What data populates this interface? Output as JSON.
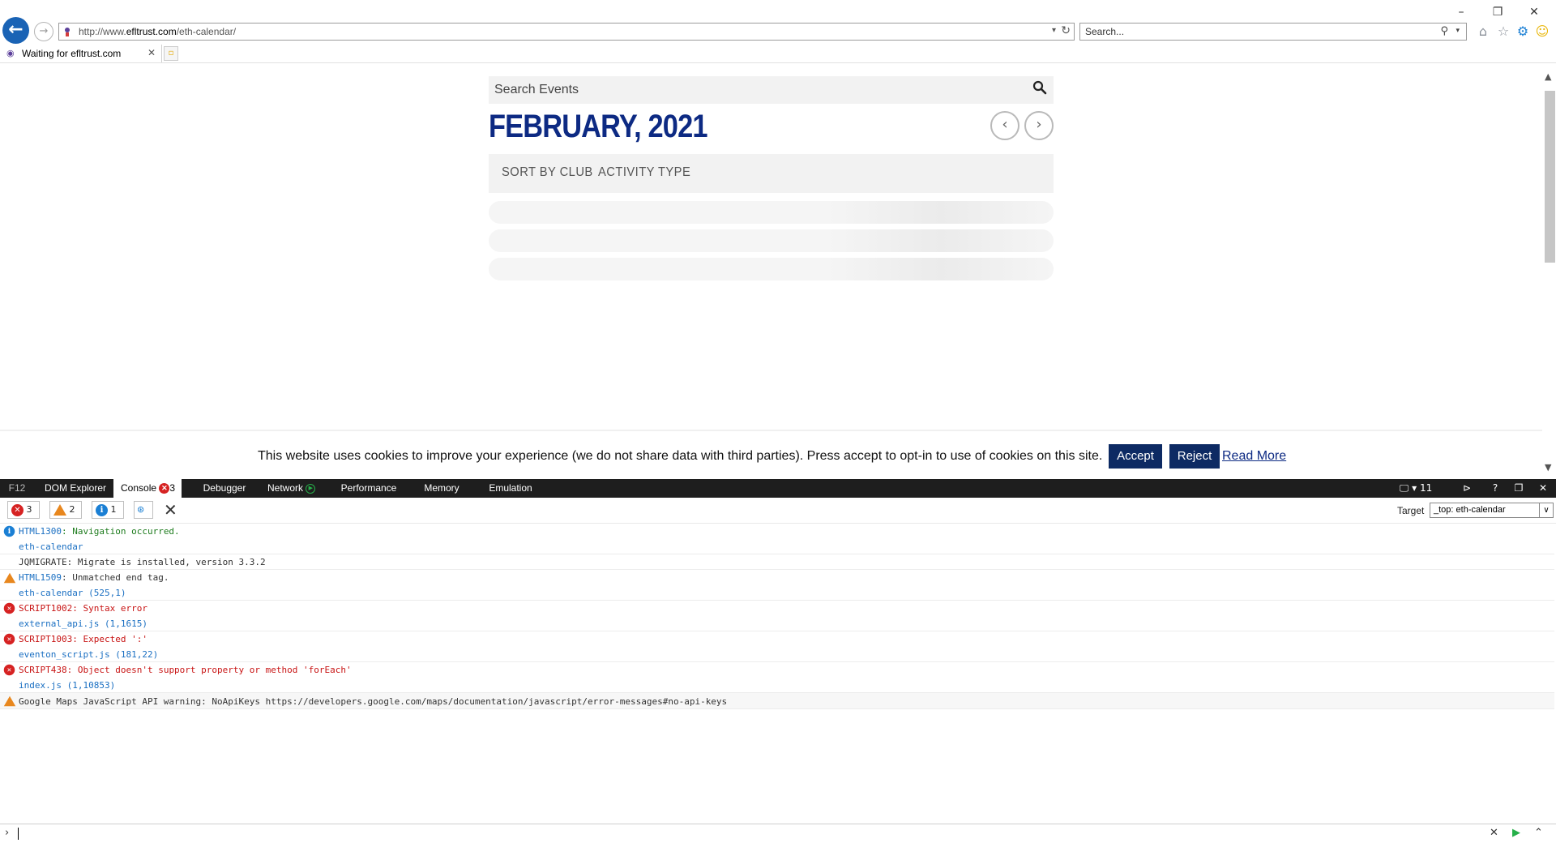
{
  "browser": {
    "address": {
      "url_prefix": "http://www.",
      "url_domain": "efltrust.com",
      "url_path": "/eth-calendar/"
    },
    "search_placeholder": "Search...",
    "tab_title": "Waiting for efltrust.com",
    "window": {
      "minimize": "–",
      "restore": "❐",
      "close": "✕"
    }
  },
  "page": {
    "search_placeholder": "Search Events",
    "month": "FEBRUARY, 2021",
    "filters": [
      "SORT BY CLUB",
      "ACTIVITY TYPE"
    ],
    "cookie": {
      "text": "This website uses cookies to improve your experience (we do not share data with third parties). Press accept to opt-in to use of cookies on this site.",
      "accept": "Accept",
      "reject": "Reject",
      "read_more": "Read More"
    }
  },
  "devtools": {
    "tabs": [
      "F12",
      "DOM Explorer",
      "Console",
      "Debugger",
      "Network",
      "Performance",
      "Memory",
      "Emulation"
    ],
    "console_error_badge": "3",
    "doc_mode": "11",
    "filters": {
      "errors": "3",
      "warnings": "2",
      "info": "1"
    },
    "target_label": "Target",
    "target_value": "_top: eth-calendar",
    "log": [
      {
        "type": "info",
        "code": "HTML1300",
        "message": ": Navigation occurred.",
        "source": "eth-calendar",
        "extra": "JQMIGRATE: Migrate is installed, version 3.3.2"
      },
      {
        "type": "warn",
        "code": "HTML1509",
        "message": ": Unmatched end tag.",
        "source": "eth-calendar (525,1)"
      },
      {
        "type": "error",
        "code": "SCRIPT1002",
        "message": ": Syntax error",
        "source": "external_api.js (1,1615)"
      },
      {
        "type": "error",
        "code": "SCRIPT1003",
        "message": ": Expected ':'",
        "source": "eventon_script.js (181,22)"
      },
      {
        "type": "error",
        "code": "SCRIPT438",
        "message": ": Object doesn't support property or method 'forEach'",
        "source": "index.js (1,10853)"
      },
      {
        "type": "warn",
        "code": "",
        "message": "Google Maps JavaScript API warning: NoApiKeys https://developers.google.com/maps/documentation/javascript/error-messages#no-api-keys",
        "source": ""
      }
    ]
  },
  "colors": {
    "brand_navy": "#0d2a83",
    "button_navy": "#0d2a63",
    "error": "#d62222",
    "warning": "#e8871e",
    "info": "#1a7fd4"
  }
}
